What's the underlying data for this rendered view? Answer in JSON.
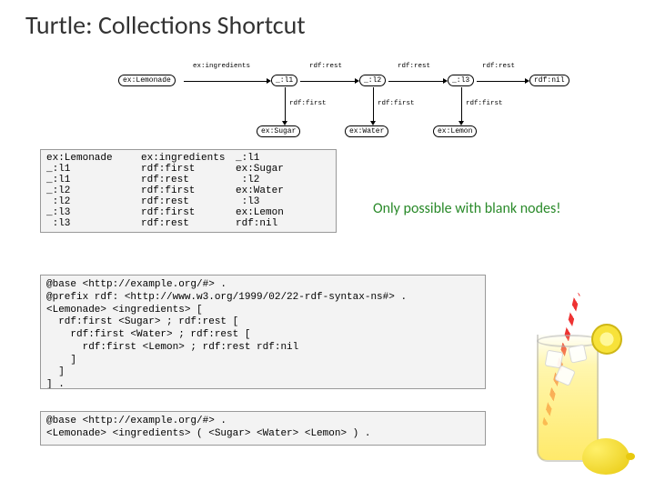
{
  "title": "Turtle: Collections Shortcut",
  "graph": {
    "nodes": {
      "lemonade": "ex:Lemonade",
      "l1": "_:l1",
      "l2": "_:l2",
      "l3": "_:l3",
      "nil": "rdf:nil",
      "sugar": "ex:Sugar",
      "water": "ex:Water",
      "lemon": "ex:Lemon"
    },
    "edges": {
      "ingredients": "ex:ingredients",
      "rest": "rdf:rest",
      "first": "rdf:first"
    }
  },
  "triples": {
    "col1": "ex:Lemonade\n_:l1\n_:l1\n_:l2\n :l2\n_:l3\n :l3",
    "col2": "ex:ingredients\nrdf:first\nrdf:rest\nrdf:first\nrdf:rest\nrdf:first\nrdf:rest",
    "col3": "_:l1\nex:Sugar\n :l2\nex:Water\n :l3\nex:Lemon\nrdf:nil"
  },
  "note": "Only possible with blank nodes!",
  "code1": "@base <http://example.org/#> .\n@prefix rdf: <http://www.w3.org/1999/02/22-rdf-syntax-ns#> .\n<Lemonade> <ingredients> [\n  rdf:first <Sugar> ; rdf:rest [\n    rdf:first <Water> ; rdf:rest [\n      rdf:first <Lemon> ; rdf:rest rdf:nil\n    ]\n  ]\n] .",
  "code2": "@base <http://example.org/#> .\n<Lemonade> <ingredients> ( <Sugar> <Water> <Lemon> ) ."
}
